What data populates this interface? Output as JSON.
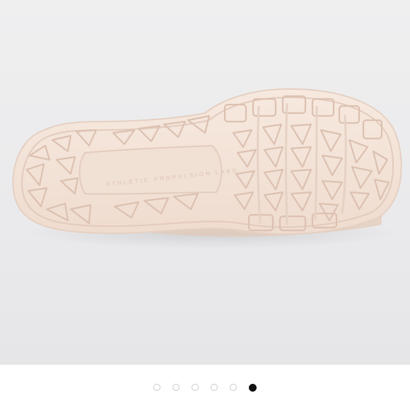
{
  "gallery": {
    "image_alt": "shoe-outsole-photo",
    "outsole_text": "ATHLETIC PROPULSION LABS",
    "slide_count": 6,
    "active_index": 5,
    "colors": {
      "background": "#ececee",
      "outsole": "#f4e4d9",
      "outsole_shadow": "#d8c0b0",
      "dot_active": "#111111",
      "dot_inactive_border": "#c9c9c9"
    }
  },
  "dots": [
    {
      "label": "Slide 1"
    },
    {
      "label": "Slide 2"
    },
    {
      "label": "Slide 3"
    },
    {
      "label": "Slide 4"
    },
    {
      "label": "Slide 5"
    },
    {
      "label": "Slide 6"
    }
  ]
}
